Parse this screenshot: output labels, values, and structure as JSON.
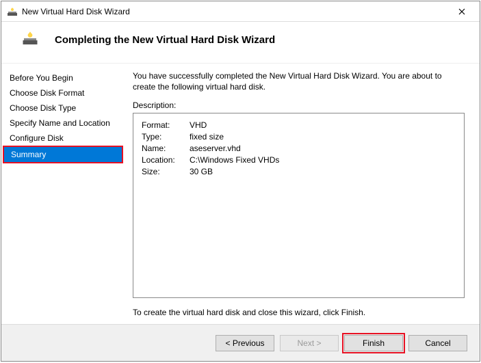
{
  "window": {
    "title": "New Virtual Hard Disk Wizard"
  },
  "header": {
    "title": "Completing the New Virtual Hard Disk Wizard"
  },
  "sidebar": {
    "items": [
      {
        "label": "Before You Begin"
      },
      {
        "label": "Choose Disk Format"
      },
      {
        "label": "Choose Disk Type"
      },
      {
        "label": "Specify Name and Location"
      },
      {
        "label": "Configure Disk"
      },
      {
        "label": "Summary"
      }
    ]
  },
  "content": {
    "intro": "You have successfully completed the New Virtual Hard Disk Wizard. You are about to create the following virtual hard disk.",
    "desc_label": "Description:",
    "rows": [
      {
        "k": "Format:",
        "v": "VHD"
      },
      {
        "k": "Type:",
        "v": "fixed size"
      },
      {
        "k": "Name:",
        "v": "aseserver.vhd"
      },
      {
        "k": "Location:",
        "v": "C:\\Windows Fixed VHDs"
      },
      {
        "k": "Size:",
        "v": "30 GB"
      }
    ],
    "footer": "To create the virtual hard disk and close this wizard, click Finish."
  },
  "buttons": {
    "previous": "< Previous",
    "next": "Next >",
    "finish": "Finish",
    "cancel": "Cancel"
  }
}
